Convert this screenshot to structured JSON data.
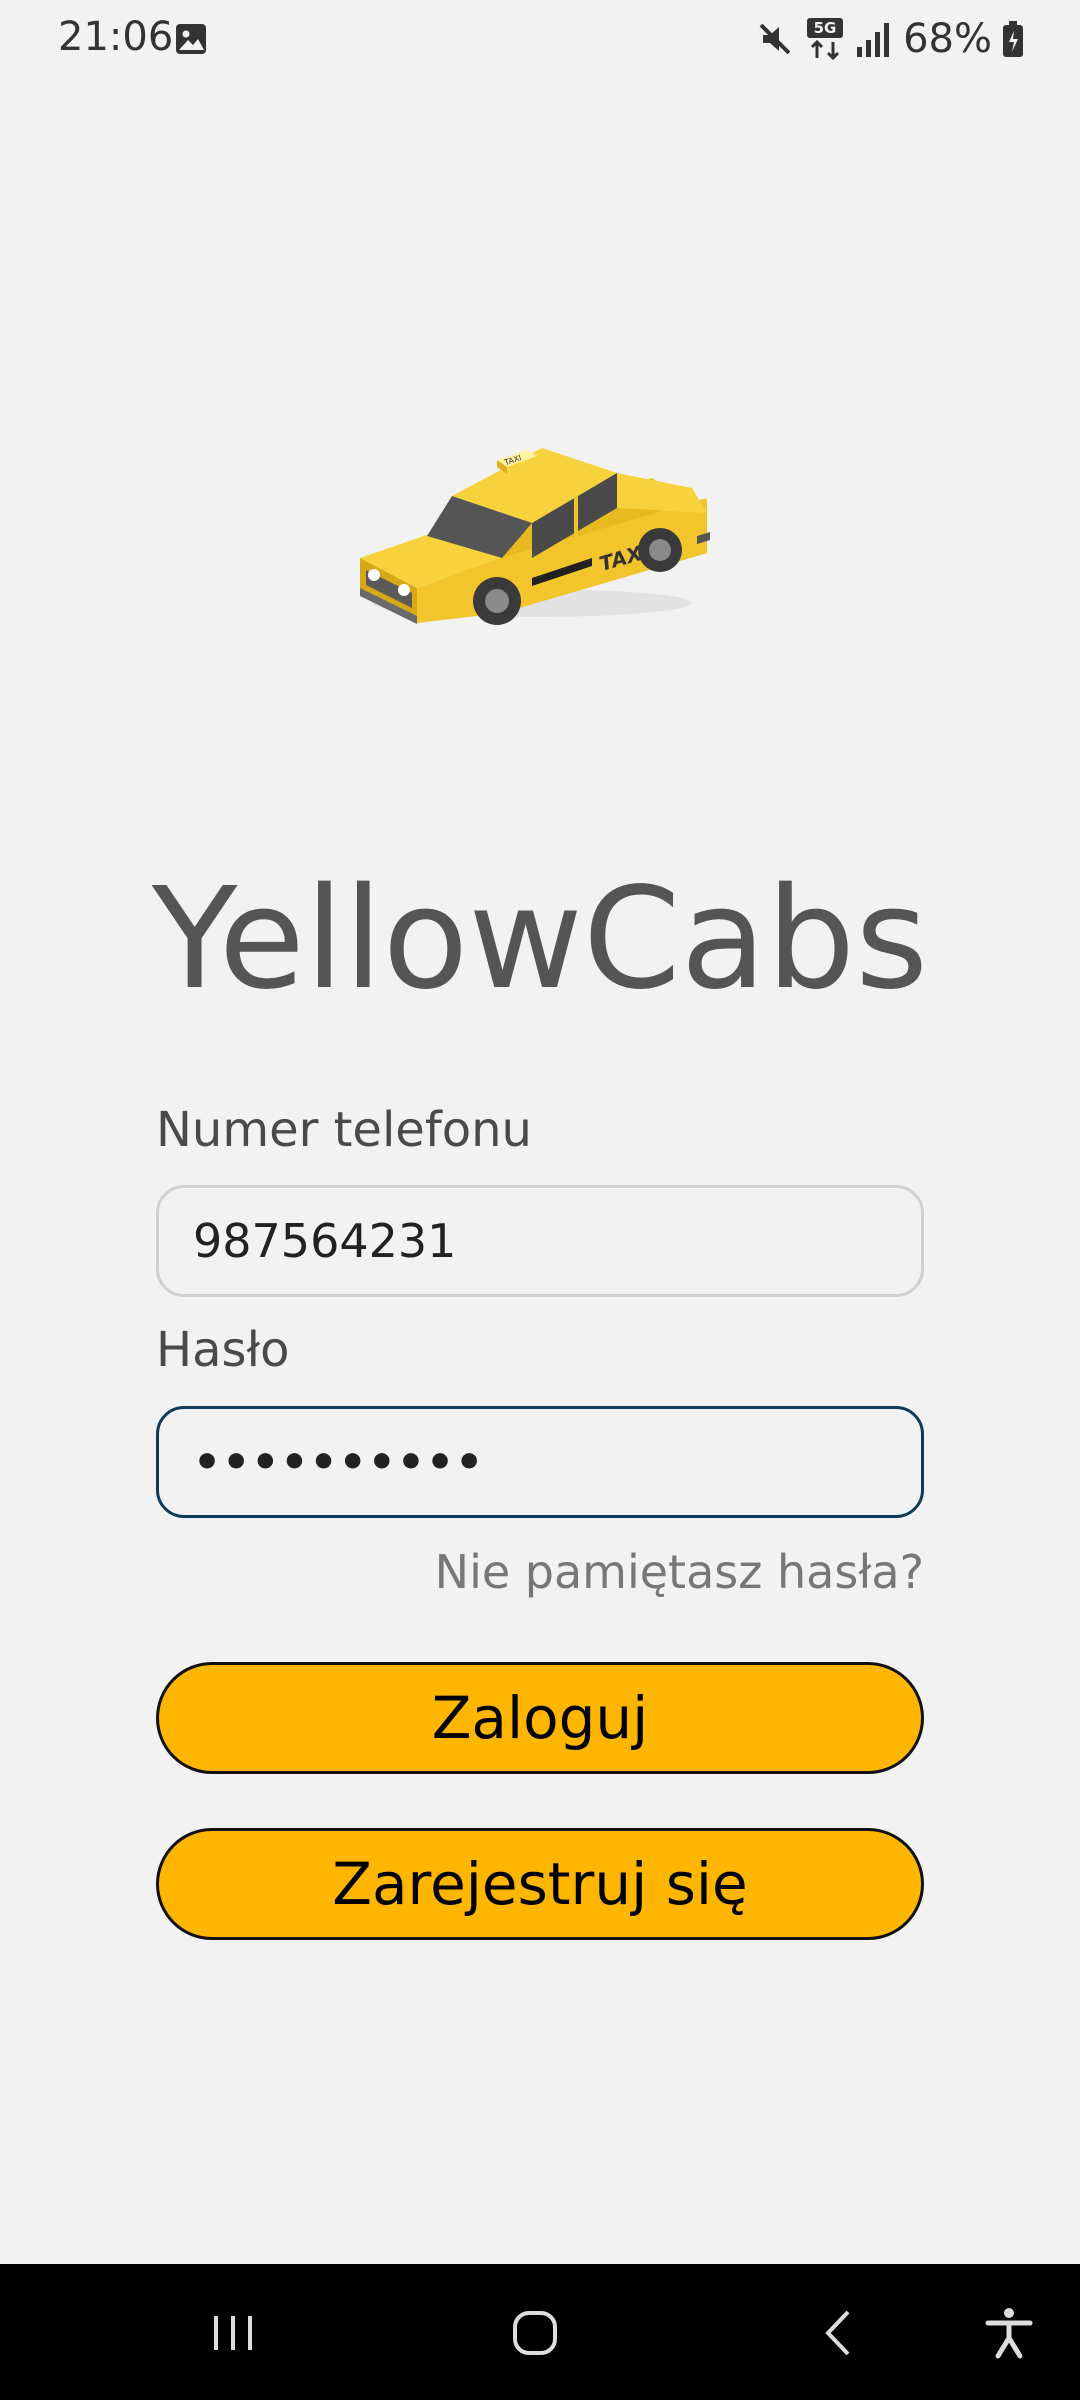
{
  "status_bar": {
    "time": "21:06",
    "battery": "68%",
    "icons": [
      "gallery-icon",
      "mute-icon",
      "5g-icon",
      "signal-icon",
      "battery-icon"
    ]
  },
  "app": {
    "logo": "taxi-car-icon",
    "title": "YellowCabs"
  },
  "form": {
    "phone_label": "Numer telefonu",
    "phone_value": "987564231",
    "password_label": "Hasło",
    "password_value": "••••••••••",
    "forgot_password": "Nie pamiętasz hasła?"
  },
  "buttons": {
    "login": "Zaloguj",
    "register": "Zarejestruj się"
  },
  "nav_bar": {
    "icons": [
      "recents-icon",
      "home-icon",
      "back-icon",
      "accessibility-icon"
    ]
  },
  "colors": {
    "background": "#f2f2f2",
    "accent": "#ffb600",
    "focused_border": "#0e3a5c"
  }
}
